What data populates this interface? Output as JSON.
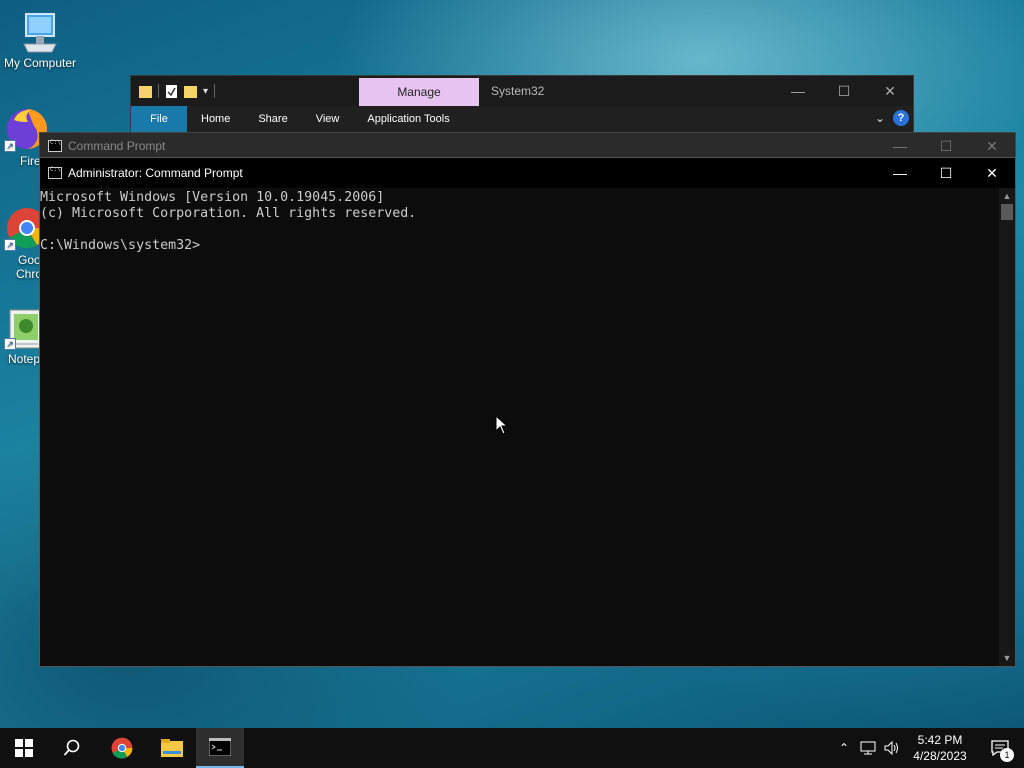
{
  "desktop": {
    "icons": [
      {
        "label": "My Computer"
      },
      {
        "label": "Fire"
      },
      {
        "label": "Goo"
      },
      {
        "label": "Chro"
      },
      {
        "label": "Notep"
      }
    ]
  },
  "explorer": {
    "manage_tab": "Manage",
    "title": "System32",
    "ribbon_tabs": [
      "File",
      "Home",
      "Share",
      "View",
      "Application Tools"
    ],
    "help": "?"
  },
  "cmd_back": {
    "title": "Command Prompt"
  },
  "cmd": {
    "title": "Administrator: Command Prompt",
    "lines": [
      "Microsoft Windows [Version 10.0.19045.2006]",
      "(c) Microsoft Corporation. All rights reserved.",
      "",
      "C:\\Windows\\system32>"
    ]
  },
  "taskbar": {
    "time": "5:42 PM",
    "date": "4/28/2023",
    "notification_count": "1"
  },
  "colors": {
    "accent": "#76b9ed",
    "manage_tab": "#e7c4f0",
    "file_tab": "#1979a9",
    "console_bg": "#0c0c0c",
    "console_text": "#cccccc"
  }
}
